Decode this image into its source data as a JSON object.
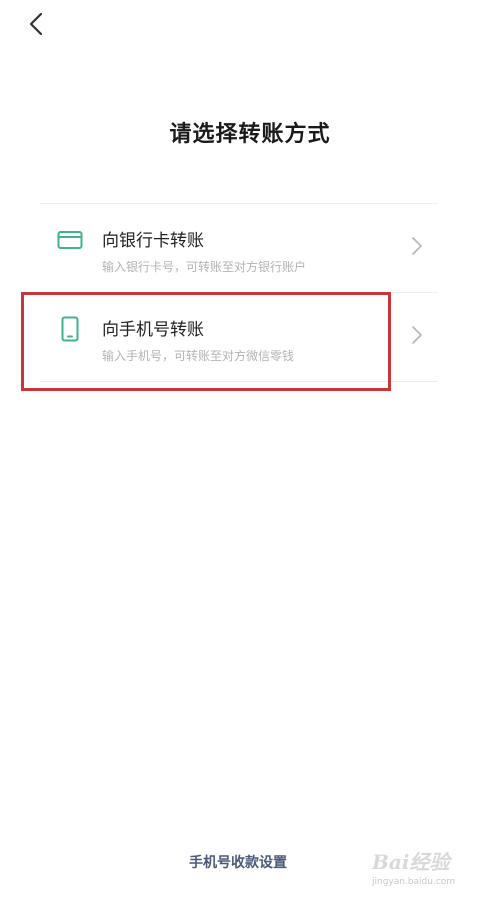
{
  "header": {
    "back_icon": "chevron-left-icon",
    "title": "请选择转账方式"
  },
  "options": [
    {
      "icon": "bank-card-icon",
      "title": "向银行卡转账",
      "description": "输入银行卡号，可转账至对方银行账户"
    },
    {
      "icon": "mobile-phone-icon",
      "title": "向手机号转账",
      "description": "输入手机号，可转账至对方微信零钱"
    }
  ],
  "footer": {
    "link_label": "手机号收款设置"
  },
  "watermark": {
    "logo": "Bai经验",
    "url": "jingyan.baidu.com"
  },
  "colors": {
    "accent_green": "#3fb38a",
    "highlight_red": "#c8363d",
    "footer_link": "#4a5a7a"
  }
}
